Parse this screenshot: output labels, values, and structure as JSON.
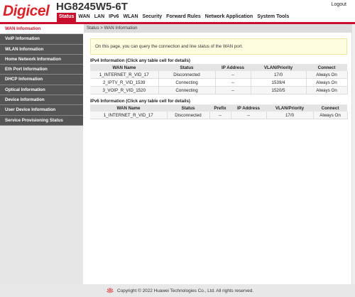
{
  "header": {
    "brand": "Digicel",
    "model": "HG8245W5-6T",
    "logout": "Logout",
    "tabs": [
      "Status",
      "WAN",
      "LAN",
      "IPv6",
      "WLAN",
      "Security",
      "Forward Rules",
      "Network Application",
      "System Tools"
    ],
    "active_tab": "Status"
  },
  "colors": {
    "accent": "#c8102e",
    "brand": "#d8232a"
  },
  "sidebar": {
    "items": [
      {
        "label": "WAN Information",
        "active": true
      },
      {
        "label": "VoIP Information"
      },
      {
        "label": "WLAN Information"
      },
      {
        "label": "Home Network Information"
      },
      {
        "label": "Eth Port Information"
      },
      {
        "label": "DHCP Information"
      },
      {
        "label": "Optical Information"
      },
      {
        "label": "Device Information"
      },
      {
        "label": "User Device Information"
      },
      {
        "label": "Service Provisioning Status"
      }
    ]
  },
  "main": {
    "breadcrumb": "Status > WAN Information",
    "notice": "On this page, you can query the connection and line status of the WAN port.",
    "ipv4": {
      "title": "IPv4 Information (Click any table cell for details)",
      "headers": [
        "WAN Name",
        "Status",
        "IP Address",
        "VLAN/Priority",
        "Connect"
      ],
      "rows": [
        [
          "1_INTERNET_R_VID_17",
          "Disconnected",
          "--",
          "17/0",
          "Always On"
        ],
        [
          "2_IPTV_R_VID_1539",
          "Connecting",
          "--",
          "1539/4",
          "Always On"
        ],
        [
          "3_VOIP_R_VID_1520",
          "Connecting",
          "--",
          "1520/5",
          "Always On"
        ]
      ]
    },
    "ipv6": {
      "title": "IPv6 Information (Click any table cell for details)",
      "headers": [
        "WAN Name",
        "Status",
        "Prefix",
        "IP Address",
        "VLAN/Priority",
        "Connect"
      ],
      "rows": [
        [
          "1_INTERNET_R_VID_17",
          "Disconnected",
          "--",
          "--",
          "17/0",
          "Always On"
        ]
      ]
    }
  },
  "footer": {
    "icon": "huawei-logo-icon",
    "copyright": "Copyright © 2022 Huawei Technologies Co., Ltd. All rights reserved."
  }
}
